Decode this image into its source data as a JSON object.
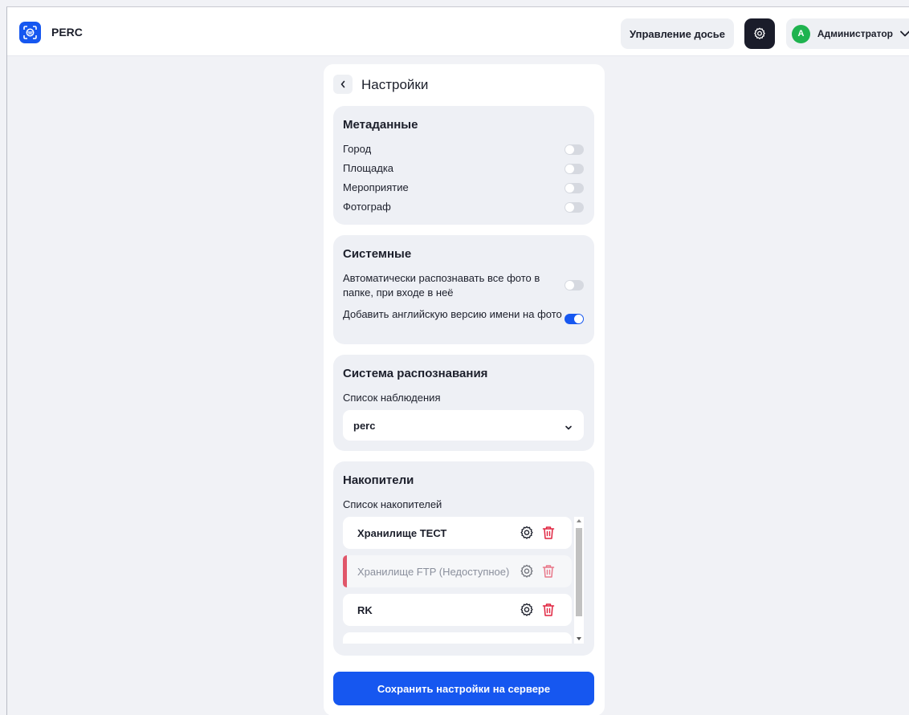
{
  "header": {
    "brand": "PERC",
    "dossier_button": "Управление досье",
    "user": {
      "initial": "A",
      "name": "Администратор"
    }
  },
  "panel": {
    "title": "Настройки",
    "metadata": {
      "title": "Метаданные",
      "rows": [
        {
          "label": "Город",
          "enabled": false
        },
        {
          "label": "Площадка",
          "enabled": false
        },
        {
          "label": "Мероприятие",
          "enabled": false
        },
        {
          "label": "Фотограф",
          "enabled": false
        }
      ]
    },
    "system": {
      "title": "Системные",
      "rows": [
        {
          "label": "Автоматически распознавать все фото в папке, при входе в неё",
          "enabled": false
        },
        {
          "label": "Добавить английскую версию имени на фото",
          "enabled": true
        }
      ]
    },
    "recognition": {
      "title": "Система распознавания",
      "watchlist_label": "Список наблюдения",
      "watchlist_value": "perc"
    },
    "storages": {
      "title": "Накопители",
      "list_label": "Список накопителей",
      "items": [
        {
          "name": "Хранилище ТЕСТ",
          "available": true
        },
        {
          "name": "Хранилище FTP (Недоступное)",
          "available": false
        },
        {
          "name": "RK",
          "available": true
        }
      ]
    },
    "save_button": "Сохранить настройки на сервере"
  },
  "colors": {
    "accent": "#1657f0",
    "header_dark": "#1a1c2a",
    "avatar": "#1fb34f",
    "delete": "#e0233f",
    "unavailable_marker": "#e0566a"
  }
}
